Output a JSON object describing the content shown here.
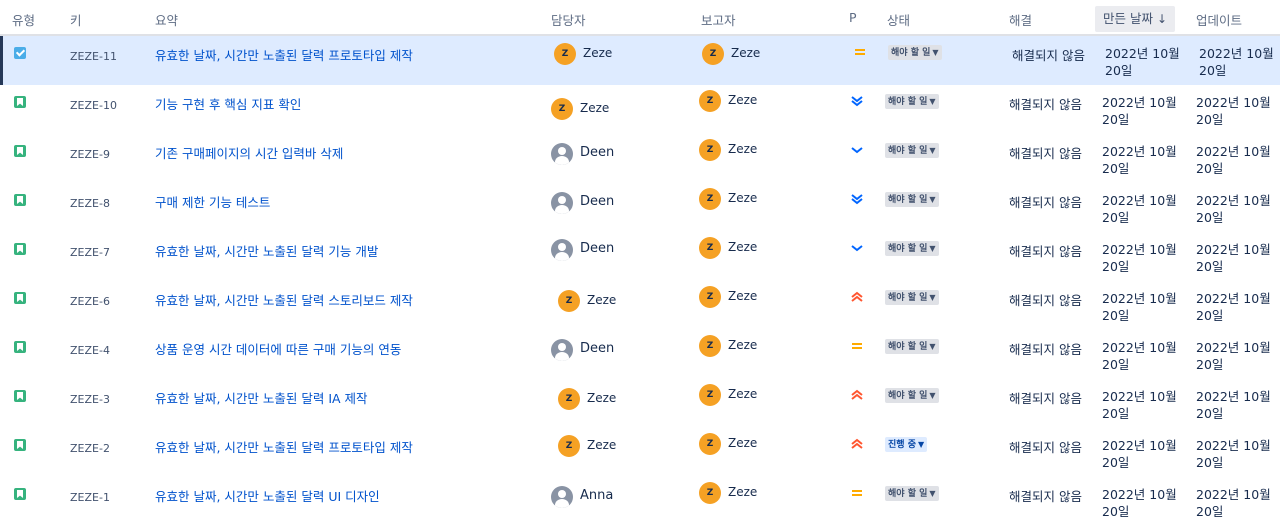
{
  "header": {
    "type": "유형",
    "key": "키",
    "summary": "요약",
    "assignee": "담당자",
    "reporter": "보고자",
    "priority": "P",
    "status": "상태",
    "resolution": "해결",
    "due": "만든 날짜",
    "due_sort_icon": "arrow-down",
    "updated": "업데이트"
  },
  "colors": {
    "link": "#0052cc",
    "selected_row": "#deebff",
    "story": "#36b37e",
    "task": "#4bade8",
    "avatar_z": "#f5a124",
    "priority_medium": "#ffab00",
    "priority_high": "#ff5630",
    "priority_low": "#0065ff"
  },
  "rows": [
    {
      "type": "check",
      "key": "ZEZE-11",
      "summary": "유효한 날짜, 시간만 노출된 달력 프로토타입 제작",
      "assignee": {
        "name": "Zeze",
        "initial": "Z",
        "avatar": "z"
      },
      "reporter": {
        "name": "Zeze",
        "initial": "Z"
      },
      "priority": "medium",
      "status": "해야 할 일",
      "resolution": "해결되지 않음",
      "created": "2022년 10월 20일",
      "updated": "2022년 10월 20일"
    },
    {
      "type": "story",
      "key": "ZEZE-10",
      "summary": "기능 구현 후 핵심 지표 확인",
      "assignee": {
        "name": "Zeze",
        "initial": "Z",
        "avatar": "z"
      },
      "reporter": {
        "name": "Zeze",
        "initial": "Z"
      },
      "priority": "lowest",
      "status": "해야 할 일",
      "resolution": "해결되지 않음",
      "created": "2022년 10월 20일",
      "updated": "2022년 10월 20일"
    },
    {
      "type": "story",
      "key": "ZEZE-9",
      "summary": "기존 구매페이지의 시간 입력바 삭제",
      "assignee": {
        "name": "Deen",
        "initial": "",
        "avatar": "default"
      },
      "reporter": {
        "name": "Zeze",
        "initial": "Z"
      },
      "priority": "low",
      "status": "해야 할 일",
      "resolution": "해결되지 않음",
      "created": "2022년 10월 20일",
      "updated": "2022년 10월 20일"
    },
    {
      "type": "story",
      "key": "ZEZE-8",
      "summary": "구매 제한 기능 테스트",
      "assignee": {
        "name": "Deen",
        "initial": "",
        "avatar": "default"
      },
      "reporter": {
        "name": "Zeze",
        "initial": "Z"
      },
      "priority": "lowest",
      "status": "해야 할 일",
      "resolution": "해결되지 않음",
      "created": "2022년 10월 20일",
      "updated": "2022년 10월 20일"
    },
    {
      "type": "story",
      "key": "ZEZE-7",
      "summary": "유효한 날짜, 시간만 노출된 달력 기능 개발",
      "assignee": {
        "name": "Deen",
        "initial": "",
        "avatar": "default"
      },
      "reporter": {
        "name": "Zeze",
        "initial": "Z"
      },
      "priority": "low",
      "status": "해야 할 일",
      "resolution": "해결되지 않음",
      "created": "2022년 10월 20일",
      "updated": "2022년 10월 20일"
    },
    {
      "type": "story",
      "key": "ZEZE-6",
      "summary": "유효한 날짜, 시간만 노출된 달력 스토리보드 제작",
      "assignee": {
        "name": "Zeze",
        "initial": "Z",
        "avatar": "z"
      },
      "reporter": {
        "name": "Zeze",
        "initial": "Z"
      },
      "priority": "highest",
      "status": "해야 할 일",
      "resolution": "해결되지 않음",
      "created": "2022년 10월 20일",
      "updated": "2022년 10월 20일"
    },
    {
      "type": "story",
      "key": "ZEZE-4",
      "summary": "상품 운영 시간 데이터에 따른 구매 기능의 연동",
      "assignee": {
        "name": "Deen",
        "initial": "",
        "avatar": "default"
      },
      "reporter": {
        "name": "Zeze",
        "initial": "Z"
      },
      "priority": "medium",
      "status": "해야 할 일",
      "resolution": "해결되지 않음",
      "created": "2022년 10월 20일",
      "updated": "2022년 10월 20일"
    },
    {
      "type": "story",
      "key": "ZEZE-3",
      "summary": "유효한 날짜, 시간만 노출된 달력 IA 제작",
      "assignee": {
        "name": "Zeze",
        "initial": "Z",
        "avatar": "z"
      },
      "reporter": {
        "name": "Zeze",
        "initial": "Z"
      },
      "priority": "highest",
      "status": "해야 할 일",
      "resolution": "해결되지 않음",
      "created": "2022년 10월 20일",
      "updated": "2022년 10월 20일"
    },
    {
      "type": "story",
      "key": "ZEZE-2",
      "summary": "유효한 날짜, 시간만 노출된 달력 프로토타입 제작",
      "assignee": {
        "name": "Zeze",
        "initial": "Z",
        "avatar": "z"
      },
      "reporter": {
        "name": "Zeze",
        "initial": "Z"
      },
      "priority": "highest",
      "status": "진행 중",
      "resolution": "해결되지 않음",
      "created": "2022년 10월 20일",
      "updated": "2022년 10월 20일"
    },
    {
      "type": "story",
      "key": "ZEZE-1",
      "summary": "유효한 날짜, 시간만 노출된 달력 UI 디자인",
      "assignee": {
        "name": "Anna",
        "initial": "",
        "avatar": "default"
      },
      "reporter": {
        "name": "Zeze",
        "initial": "Z"
      },
      "priority": "medium",
      "status": "해야 할 일",
      "resolution": "해결되지 않음",
      "created": "2022년 10월 20일",
      "updated": "2022년 10월 20일"
    }
  ]
}
